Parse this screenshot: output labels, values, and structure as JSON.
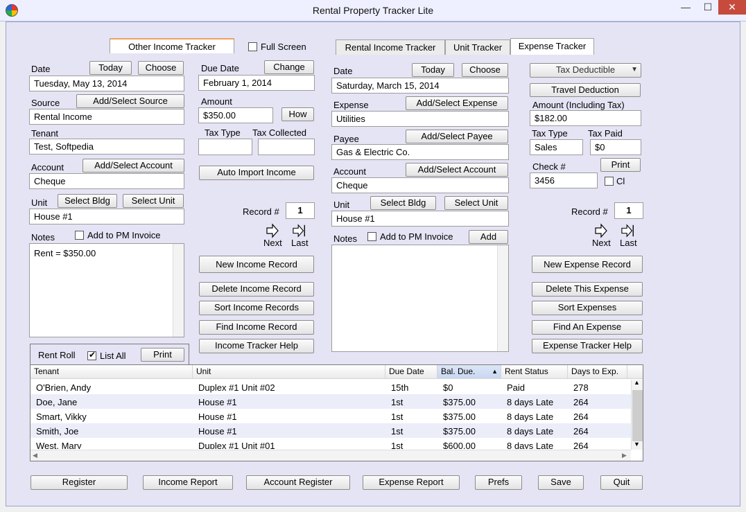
{
  "window": {
    "title": "Rental Property Tracker Lite",
    "minimize": "—",
    "maximize": "☐",
    "close": "✕",
    "app_icon": "app-logo-icon"
  },
  "tabs": {
    "other_income": "Other Income Tracker",
    "full_screen": "Full Screen",
    "rental_income": "Rental Income Tracker",
    "unit": "Unit Tracker",
    "expense": "Expense Tracker"
  },
  "income": {
    "date_label": "Date",
    "today": "Today",
    "choose": "Choose",
    "date": "Tuesday, May 13, 2014",
    "source_label": "Source",
    "add_source": "Add/Select Source",
    "source": "Rental Income",
    "tenant_label": "Tenant",
    "tenant": "Test, Softpedia",
    "account_label": "Account",
    "add_account": "Add/Select Account",
    "account": "Cheque",
    "unit_label": "Unit",
    "select_bldg": "Select Bldg",
    "select_unit": "Select Unit",
    "unit": "House #1",
    "add_pm": "Add to PM Invoice",
    "notes_label": "Notes",
    "notes": "Rent = $350.00",
    "due_label": "Due Date",
    "change": "Change",
    "due_date": "February 1, 2014",
    "amount_label": "Amount",
    "amount": "$350.00",
    "how": "How",
    "tax_type_label": "Tax Type",
    "tax_collected_label": "Tax Collected",
    "tax_type": "",
    "tax_collected": "",
    "auto_import": "Auto Import Income",
    "record_label": "Record #",
    "record": "1",
    "next": "Next",
    "last": "Last",
    "new": "New Income Record",
    "delete": "Delete Income Record",
    "sort": "Sort Income Records",
    "find": "Find Income Record",
    "help": "Income Tracker Help"
  },
  "expense": {
    "date_label": "Date",
    "today": "Today",
    "choose": "Choose",
    "date": "Saturday, March 15, 2014",
    "expense_label": "Expense",
    "add_expense": "Add/Select Expense",
    "expense": "Utilities",
    "payee_label": "Payee",
    "add_payee": "Add/Select Payee",
    "payee": "Gas & Electric Co.",
    "account_label": "Account",
    "add_account": "Add/Select Account",
    "account": "Cheque",
    "unit_label": "Unit",
    "select_bldg": "Select Bldg",
    "select_unit": "Select Unit",
    "unit": "House #1",
    "notes_label": "Notes",
    "add_pm": "Add to PM Invoice",
    "add": "Add",
    "notes": "",
    "tax_deductible": "Tax Deductible",
    "travel": "Travel Deduction",
    "amount_label": "Amount (Including Tax)",
    "amount": "$182.00",
    "tax_type_label": "Tax Type",
    "tax_paid_label": "Tax Paid",
    "tax_type": "Sales",
    "tax_paid": "$0",
    "check_label": "Check #",
    "print": "Print",
    "check": "3456",
    "cl": "Cl",
    "record_label": "Record #",
    "record": "1",
    "next": "Next",
    "last": "Last",
    "new": "New Expense Record",
    "delete": "Delete This Expense",
    "sort": "Sort Expenses",
    "find": "Find An Expense",
    "help": "Expense Tracker Help"
  },
  "rent_roll": {
    "label": "Rent Roll",
    "list_all": "List All",
    "print": "Print",
    "columns": [
      "Tenant",
      "Unit",
      "Due Date",
      "Bal. Due.",
      "Rent Status",
      "Days to Exp."
    ],
    "rows": [
      [
        "O'Brien, Andy",
        "Duplex #1 Unit #02",
        "15th",
        "$0",
        "Paid",
        "278"
      ],
      [
        "Doe, Jane",
        "House #1",
        "1st",
        "$375.00",
        "8 days Late",
        "264"
      ],
      [
        "Smart, Vikky",
        "House #1",
        "1st",
        "$375.00",
        "8 days Late",
        "264"
      ],
      [
        "Smith, Joe",
        "House #1",
        "1st",
        "$375.00",
        "8 days Late",
        "264"
      ],
      [
        "West, Mary",
        "Duplex #1 Unit #01",
        "1st",
        "$600.00",
        "8 days Late",
        "264"
      ]
    ]
  },
  "footer": {
    "register": "Register",
    "income_report": "Income Report",
    "account_register": "Account Register",
    "expense_report": "Expense Report",
    "prefs": "Prefs",
    "save": "Save",
    "quit": "Quit"
  }
}
